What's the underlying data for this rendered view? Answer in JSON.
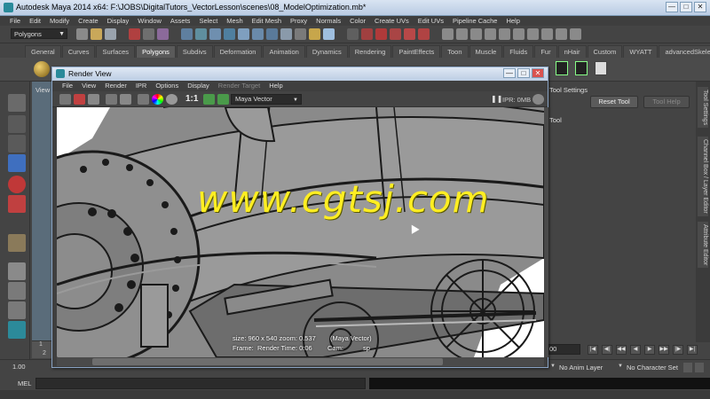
{
  "titlebar": {
    "title": "Autodesk Maya 2014 x64: F:\\JOBS\\DigitalTutors_VectorLesson\\scenes\\08_ModelOptimization.mb*",
    "minimize": "—",
    "maximize": "□",
    "close": "✕"
  },
  "menubar": {
    "items": [
      "File",
      "Edit",
      "Modify",
      "Create",
      "Display",
      "Window",
      "Assets",
      "Select",
      "Mesh",
      "Edit Mesh",
      "Proxy",
      "Normals",
      "Color",
      "Create UVs",
      "Edit UVs",
      "Pipeline Cache",
      "Help"
    ]
  },
  "statusline": {
    "mode": "Polygons"
  },
  "shelf": {
    "tabs": [
      "General",
      "Curves",
      "Surfaces",
      "Polygons",
      "Subdivs",
      "Deformation",
      "Animation",
      "Dynamics",
      "Rendering",
      "PaintEffects",
      "Toon",
      "Muscle",
      "Fluids",
      "Fur",
      "nHair",
      "Custom",
      "WYATT",
      "advancedSkeleton"
    ],
    "active_tab": "Polygons"
  },
  "viewport": {
    "panel_menu": "View"
  },
  "render_view": {
    "title": "Render View",
    "menu": [
      "File",
      "View",
      "Render",
      "IPR",
      "Options",
      "Display",
      "Render Target",
      "Help"
    ],
    "disabled_menu": "Render Target",
    "ratio": "1:1",
    "renderer": "Maya Vector",
    "ipr_status": "IPR: 0MB",
    "info_size": "size: 960 x 540  zoom: 0.537",
    "info_renderer": "(Maya Vector)",
    "info_frame": "Frame:",
    "info_render_time": "Render Time: 0:06",
    "info_cam": "Cam:",
    "info_sp": "sp"
  },
  "tool_settings": {
    "header": "Tool Settings",
    "reset_button": "Reset Tool",
    "help_button": "Tool Help",
    "tool_name": "Tool"
  },
  "side_tabs": [
    "Tool Settings",
    "Channel Box / Layer Editor",
    "Attribute Editor"
  ],
  "time_slider": {
    "tick_labels": [
      "1",
      "2"
    ]
  },
  "range": {
    "start": "1.00",
    "anim_layer": "No Anim Layer",
    "character_set": "No Character Set",
    "end_field": "00"
  },
  "command_line": {
    "label": "MEL"
  },
  "watermark": {
    "text": "www.cgtsj.com"
  },
  "colors": {
    "accent_window_title": "#bccde3",
    "watermark": "#ffee22",
    "ui_background": "#444444"
  }
}
